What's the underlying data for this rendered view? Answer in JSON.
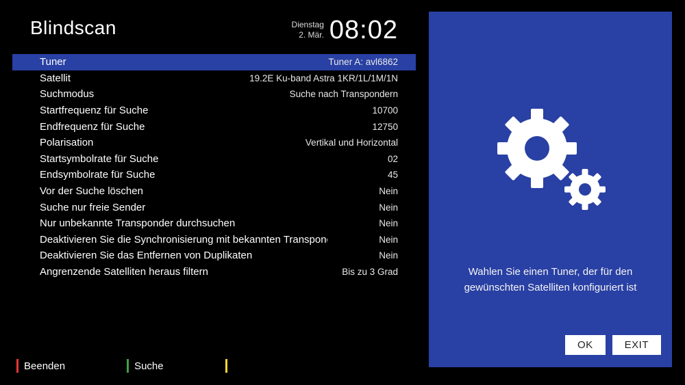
{
  "header": {
    "title": "Blindscan",
    "day": "Dienstag",
    "date": "2. Mär.",
    "clock": "08:02"
  },
  "list": [
    {
      "label": "Tuner",
      "value": "Tuner A: avl6862",
      "selected": true
    },
    {
      "label": "Satellit",
      "value": "19.2E Ku-band Astra 1KR/1L/1M/1N"
    },
    {
      "label": "Suchmodus",
      "value": "Suche nach Transpondern"
    },
    {
      "label": "Startfrequenz für Suche",
      "value": "10700"
    },
    {
      "label": "Endfrequenz für Suche",
      "value": "12750"
    },
    {
      "label": "Polarisation",
      "value": "Vertikal und Horizontal"
    },
    {
      "label": "Startsymbolrate für Suche",
      "value": "02"
    },
    {
      "label": "Endsymbolrate für Suche",
      "value": "45"
    },
    {
      "label": "Vor der Suche löschen",
      "value": "Nein"
    },
    {
      "label": "Suche nur freie Sender",
      "value": "Nein"
    },
    {
      "label": "Nur unbekannte Transponder durchsuchen",
      "value": "Nein"
    },
    {
      "label": "Deaktivieren Sie die Synchronisierung mit bekannten Transpondern",
      "value": "Nein"
    },
    {
      "label": "Deaktivieren Sie das Entfernen von Duplikaten",
      "value": "Nein"
    },
    {
      "label": "Angrenzende Satelliten heraus filtern",
      "value": "Bis zu 3 Grad"
    }
  ],
  "footer": {
    "red": "Beenden",
    "green": "Suche",
    "yellow": ""
  },
  "panel": {
    "hint": "Wahlen Sie einen Tuner, der für den gewünschten Satelliten konfiguriert ist",
    "ok": "OK",
    "exit": "EXIT"
  }
}
